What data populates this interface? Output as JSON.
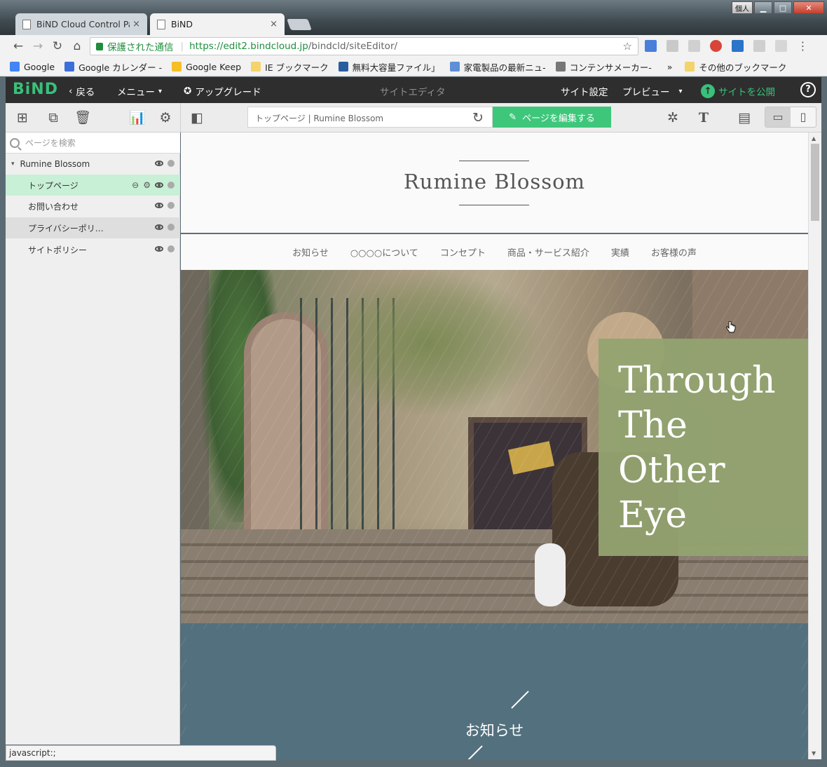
{
  "browser": {
    "tabs": [
      {
        "title": "BiND Cloud Control Pa",
        "close": "×"
      },
      {
        "title": "BiND",
        "close": "×"
      }
    ],
    "window_user": "個人",
    "address": {
      "secure_label": "保護された通信",
      "separator": "|",
      "url_host": "https://edit2.bindcloud.jp",
      "url_path": "/bindcld/siteEditor/"
    },
    "bookmarks": [
      {
        "label": "Google",
        "color": "#4285f4"
      },
      {
        "label": "Google カレンダー -",
        "color": "#3d6fd8"
      },
      {
        "label": "Google Keep",
        "color": "#f6bf26"
      },
      {
        "label": "IE ブックマーク",
        "color": "#f3d36b"
      },
      {
        "label": "無料大容量ファイル」",
        "color": "#2a5d9f"
      },
      {
        "label": "家電製品の最新ニュ-",
        "color": "#5f8fd6"
      },
      {
        "label": "コンテンサメーカー-",
        "color": "#777777"
      }
    ],
    "bookmarks_more": "»",
    "bookmarks_other": "その他のブックマーク",
    "status_text": "javascript:;"
  },
  "app": {
    "logo": "BiND",
    "back_label": "戻る",
    "menu_label": "メニュー",
    "upgrade_label": "アップグレード",
    "title": "サイトエディタ",
    "site_settings_label": "サイト設定",
    "preview_label": "プレビュー",
    "publish_label": "サイトを公開",
    "help_label": "?",
    "accent_color": "#39c07a"
  },
  "toolbar": {
    "page_path": "トップページ | Rumine Blossom",
    "edit_page_label": "ページを編集する"
  },
  "sidebar": {
    "search_placeholder": "ページを検索",
    "site_name": "Rumine Blossom",
    "pages": [
      {
        "label": "トップページ",
        "state": "selected"
      },
      {
        "label": "お問い合わせ",
        "state": "normal"
      },
      {
        "label": "プライバシーポリ…",
        "state": "hover"
      },
      {
        "label": "サイトポリシー",
        "state": "normal"
      }
    ]
  },
  "site": {
    "title": "Rumine Blossom",
    "nav": [
      "お知らせ",
      "○○○○について",
      "コンセプト",
      "商品・サービス紹介",
      "実績",
      "お客様の声"
    ],
    "hero_text": [
      "Through",
      "The",
      "Other",
      "Eye"
    ],
    "news_title": "お知らせ"
  }
}
